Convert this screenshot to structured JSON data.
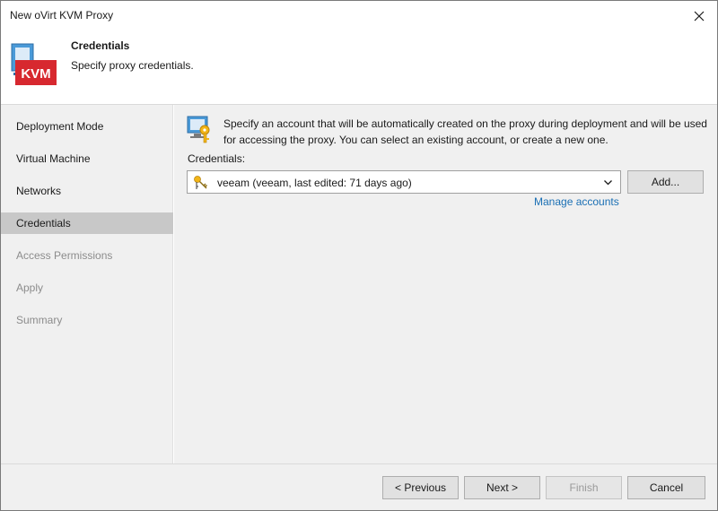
{
  "window": {
    "title": "New oVirt KVM Proxy",
    "close_symbol": "✕"
  },
  "header": {
    "title": "Credentials",
    "subtitle": "Specify proxy credentials.",
    "logo_text": "KVM"
  },
  "sidebar": {
    "items": [
      {
        "label": "Deployment Mode",
        "state": "normal"
      },
      {
        "label": "Virtual Machine",
        "state": "normal"
      },
      {
        "label": "Networks",
        "state": "normal"
      },
      {
        "label": "Credentials",
        "state": "active"
      },
      {
        "label": "Access Permissions",
        "state": "disabled"
      },
      {
        "label": "Apply",
        "state": "disabled"
      },
      {
        "label": "Summary",
        "state": "disabled"
      }
    ]
  },
  "main": {
    "description": "Specify an account that will be automatically created on the proxy during deployment and will be used for accessing the proxy. You can select an existing account, or create a new one.",
    "credentials_label": "Credentials:",
    "credentials_value": "veeam (veeam, last edited: 71 days ago)",
    "add_button": "Add...",
    "manage_link": "Manage accounts"
  },
  "footer": {
    "previous": "< Previous",
    "next": "Next >",
    "finish": "Finish",
    "cancel": "Cancel"
  },
  "colors": {
    "accent_link": "#1a6fb4",
    "kvm_red": "#d7282f",
    "sidebar_active": "#c8c8c8"
  }
}
